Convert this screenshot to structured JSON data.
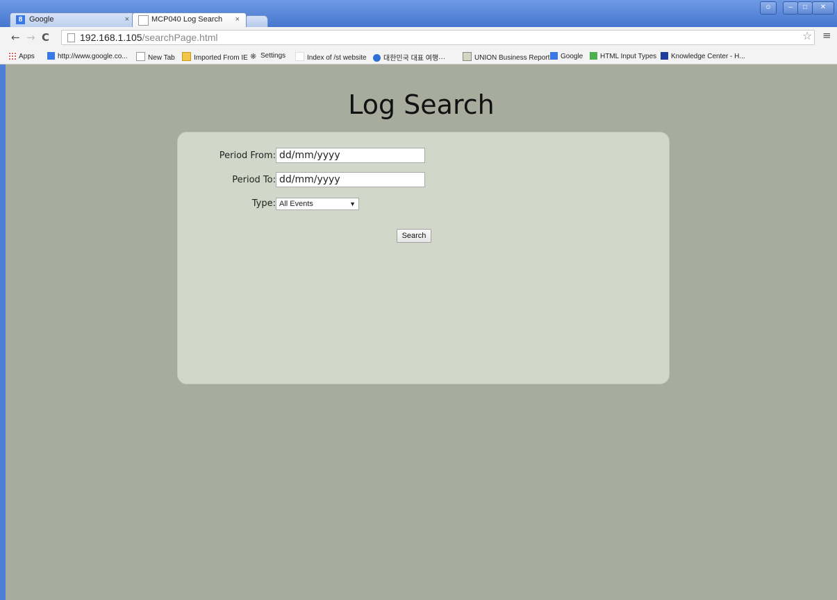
{
  "browser": {
    "tabs": [
      {
        "label": "Google",
        "active": false
      },
      {
        "label": "MCP040 Log Search",
        "active": true
      }
    ],
    "tab_close_glyph": "×",
    "url_host": "192.168.1.105",
    "url_path": "/searchPage.html",
    "bookmarks": [
      {
        "label": "Apps",
        "icon": "apps-icon"
      },
      {
        "label": "http://www.google.co...",
        "icon": "google-icon"
      },
      {
        "label": "New Tab",
        "icon": "page-icon"
      },
      {
        "label": "Imported From IE",
        "icon": "folder-icon"
      },
      {
        "label": "Settings",
        "icon": "gear-icon"
      },
      {
        "label": "Index of /st website",
        "icon": "blank-page-icon"
      },
      {
        "label": "대한민국 대표 여행···",
        "icon": "globe-icon"
      },
      {
        "label": "UNION Business Report",
        "icon": "image-icon"
      },
      {
        "label": "Google",
        "icon": "google-icon"
      },
      {
        "label": "HTML Input Types",
        "icon": "html-icon"
      },
      {
        "label": "Knowledge Center - H...",
        "icon": "ibm-icon"
      }
    ]
  },
  "page": {
    "title": "Log Search",
    "form": {
      "period_from": {
        "label": "Period From:",
        "value": "dd/mm/yyyy"
      },
      "period_to": {
        "label": "Period To:",
        "value": "dd/mm/yyyy"
      },
      "type": {
        "label": "Type:",
        "selected": "All Events"
      },
      "search_label": "Search"
    }
  },
  "colors": {
    "page_background": "#a8ac9d",
    "panel_background": "#d2d8c9",
    "title_bar": "#4f7fd4"
  }
}
